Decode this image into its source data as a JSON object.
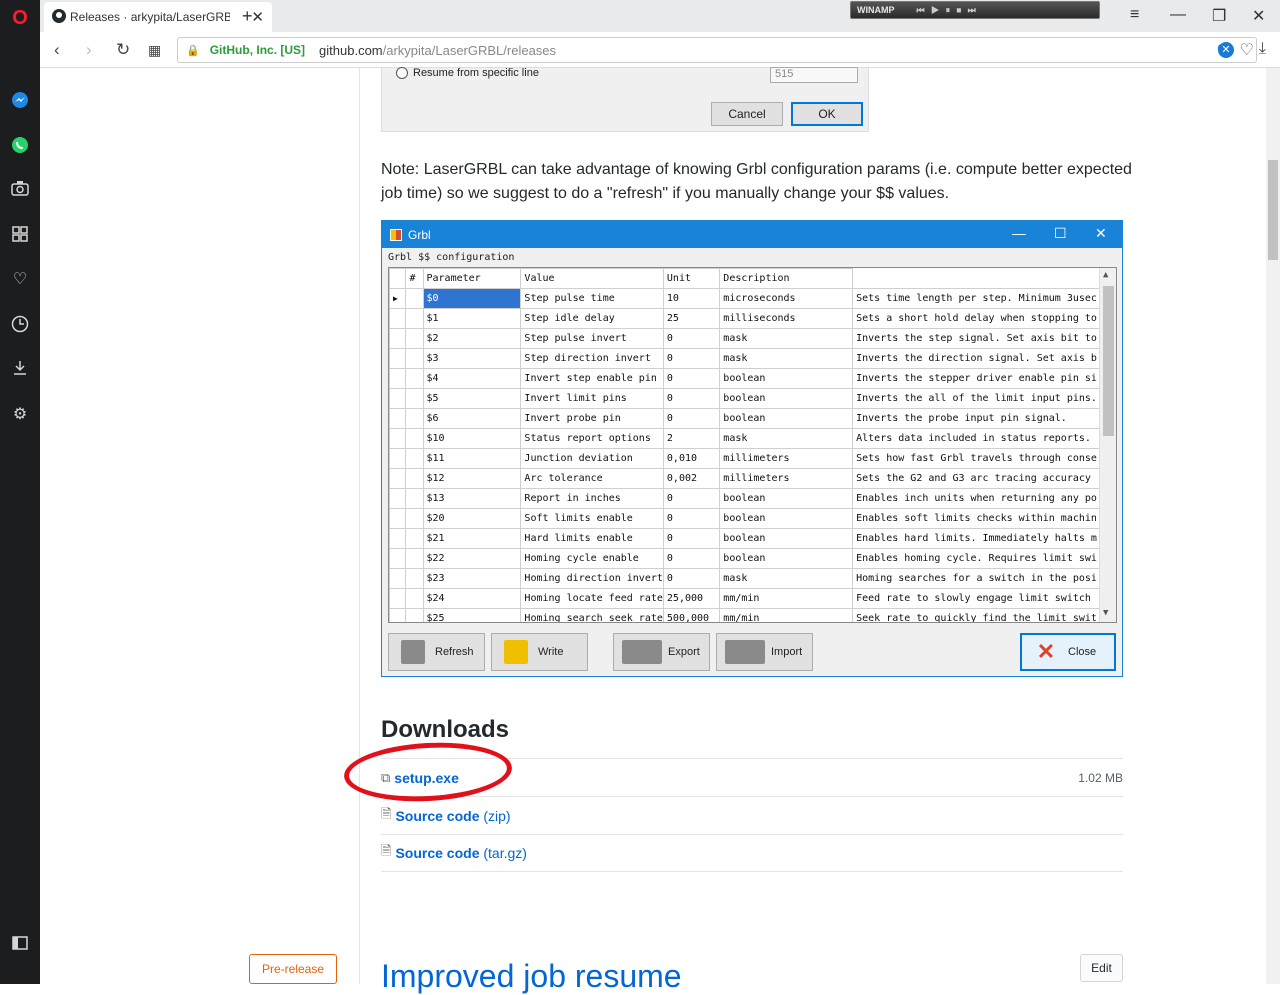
{
  "browser": {
    "tab_title": "Releases · arkypita/LaserGRBL",
    "url_cert": "GitHub, Inc. [US]",
    "url_host": "github.com",
    "url_path": "/arkypita/LaserGRBL/releases",
    "adblock_count": "0"
  },
  "winamp": {
    "label": "WINAMP",
    "controls": "⏮ ▶ ⏸ ⏹ ⏭"
  },
  "dialog": {
    "resume_label": "Resume from specific line",
    "line_value": "515",
    "cancel_label": "Cancel",
    "ok_label": "OK"
  },
  "note": "Note: LaserGRBL can take advantage of knowing Grbl configuration params (i.e. compute better expected job time) so we suggest to do a \"refresh\" if you manually change your $$ values.",
  "grbl_window": {
    "title": "Grbl",
    "group_label": "Grbl $$ configuration",
    "columns": [
      "#",
      "Parameter",
      "Value",
      "Unit",
      "Description"
    ],
    "rows": [
      [
        "$0",
        "Step pulse time",
        "10",
        "microseconds",
        "Sets time length per step. Minimum 3usec."
      ],
      [
        "$1",
        "Step idle delay",
        "25",
        "milliseconds",
        "Sets a short hold delay when stopping to..."
      ],
      [
        "$2",
        "Step pulse invert",
        "0",
        "mask",
        "Inverts the step signal. Set axis bit to..."
      ],
      [
        "$3",
        "Step direction invert",
        "0",
        "mask",
        "Inverts the direction signal. Set axis b..."
      ],
      [
        "$4",
        "Invert step enable pin",
        "0",
        "boolean",
        "Inverts the stepper driver enable pin si..."
      ],
      [
        "$5",
        "Invert limit pins",
        "0",
        "boolean",
        "Inverts the all of the limit input pins."
      ],
      [
        "$6",
        "Invert probe pin",
        "0",
        "boolean",
        "Inverts the probe input pin signal."
      ],
      [
        "$10",
        "Status report options",
        "2",
        "mask",
        "Alters data included in status reports."
      ],
      [
        "$11",
        "Junction deviation",
        "0,010",
        "millimeters",
        "Sets how fast Grbl travels through conse..."
      ],
      [
        "$12",
        "Arc tolerance",
        "0,002",
        "millimeters",
        "Sets the G2 and G3 arc tracing accuracy ..."
      ],
      [
        "$13",
        "Report in inches",
        "0",
        "boolean",
        "Enables inch units when returning any po..."
      ],
      [
        "$20",
        "Soft limits enable",
        "0",
        "boolean",
        "Enables soft limits checks within machin..."
      ],
      [
        "$21",
        "Hard limits enable",
        "0",
        "boolean",
        "Enables hard limits. Immediately halts m..."
      ],
      [
        "$22",
        "Homing cycle enable",
        "0",
        "boolean",
        "Enables homing cycle. Requires limit swi..."
      ],
      [
        "$23",
        "Homing direction invert",
        "0",
        "mask",
        "Homing searches for a switch in the posi..."
      ],
      [
        "$24",
        "Homing locate feed rate",
        "25,000",
        "mm/min",
        "Feed rate to slowly engage limit switch ..."
      ],
      [
        "$25",
        "Homing search seek rate",
        "500,000",
        "mm/min",
        "Seek rate to quickly find the limit swit..."
      ]
    ],
    "buttons": {
      "refresh": "Refresh",
      "write": "Write",
      "export": "Export",
      "import": "Import",
      "close": "Close"
    }
  },
  "downloads": {
    "heading": "Downloads",
    "files": [
      {
        "name": "setup.exe",
        "size": "1.02 MB"
      },
      {
        "name": "Source code",
        "suffix": "(zip)"
      },
      {
        "name": "Source code",
        "suffix": "(tar.gz)"
      }
    ]
  },
  "next_release": {
    "badge": "Pre-release",
    "title": "Improved job resume",
    "edit_label": "Edit"
  }
}
